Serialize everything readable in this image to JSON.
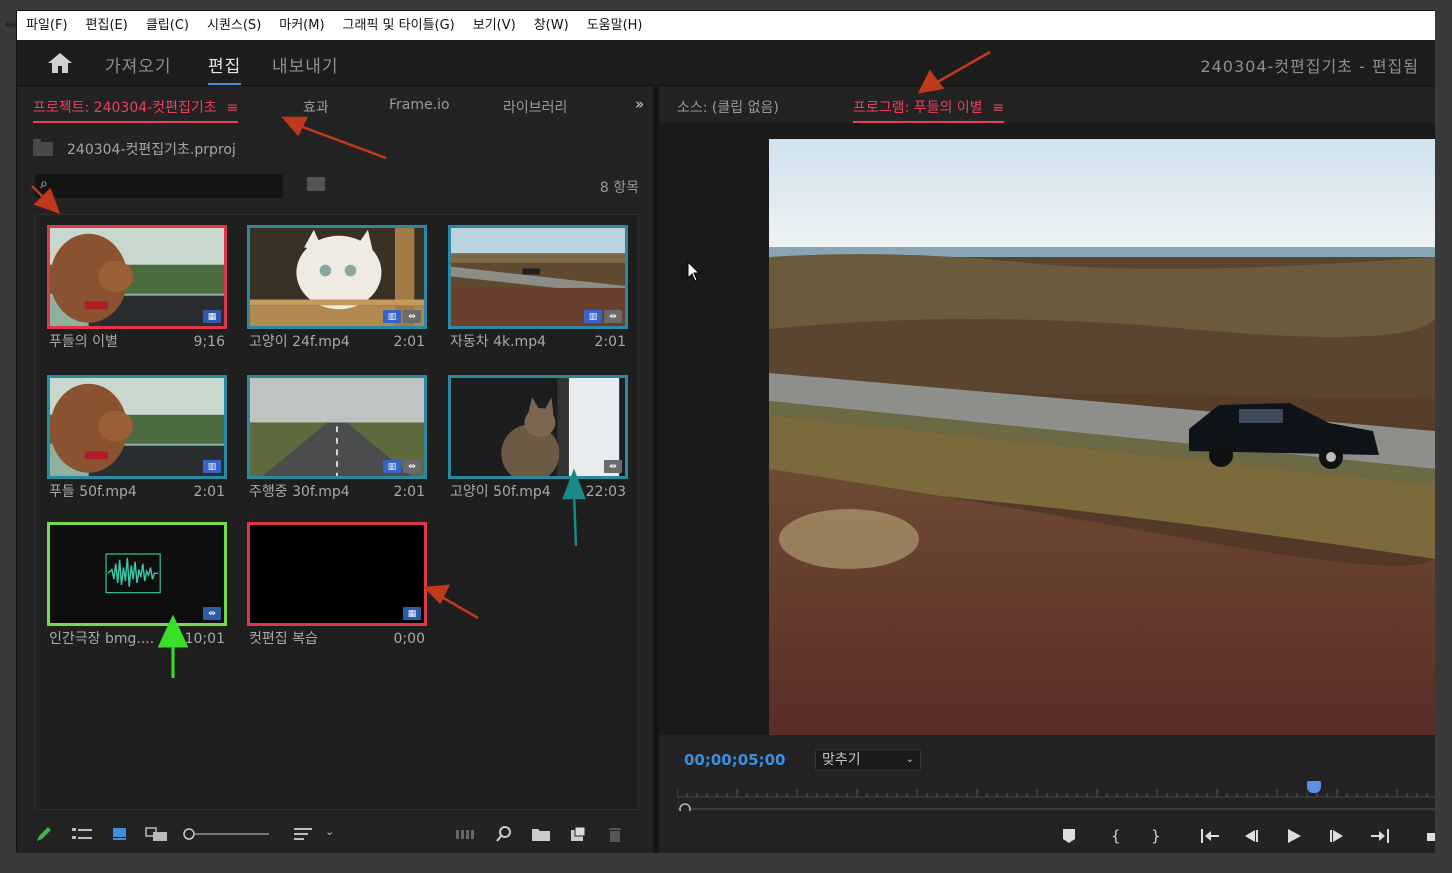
{
  "menubar": {
    "items": [
      "파일(F)",
      "편집(E)",
      "클립(C)",
      "시퀀스(S)",
      "마커(M)",
      "그래픽 및 타이틀(G)",
      "보기(V)",
      "창(W)",
      "도움말(H)"
    ]
  },
  "workspace": {
    "tabs": [
      "가져오기",
      "편집",
      "내보내기"
    ],
    "active_tab": "편집",
    "title": "240304-컷편집기초 - 편집됨"
  },
  "project_panel": {
    "tabs": {
      "project": "프로젝트: 240304-컷편집기초",
      "effects": "효과",
      "frameio": "Frame.io",
      "libraries": "라이브러리"
    },
    "project_file": "240304-컷편집기초.prproj",
    "search_placeholder": "",
    "item_count": "8 항목",
    "items": [
      {
        "name": "푸들의 이별",
        "duration": "9;16",
        "border": "#e0364a"
      },
      {
        "name": "고양이 24f.mp4",
        "duration": "2:01",
        "border": "#2c8aa0"
      },
      {
        "name": "자동차 4k.mp4",
        "duration": "2:01",
        "border": "#2c8aa0"
      },
      {
        "name": "푸들 50f.mp4",
        "duration": "2:01",
        "border": "#2c8aa0"
      },
      {
        "name": "주행중 30f.mp4",
        "duration": "2:01",
        "border": "#2c8aa0"
      },
      {
        "name": "고양이 50f.mp4",
        "duration": "22:03",
        "border": "#2c8aa0"
      },
      {
        "name": "인간극장 bmg....",
        "duration": "10;01",
        "border": "#7bd84a"
      },
      {
        "name": "컷편집 복습",
        "duration": "0;00",
        "border": "#e0364a"
      }
    ]
  },
  "monitor": {
    "source_tab": "소스: (클립 없음)",
    "program_tab": "프로그램: 푸들의 이별",
    "timecode": "00;00;05;00",
    "fit_label": "맞추기"
  },
  "colors": {
    "accent_blue": "#3d8ee0",
    "panel_active_red": "#e8415a",
    "annotation_red": "#c0391b",
    "annotation_teal": "#1a8a86",
    "annotation_green": "#38e02a"
  }
}
